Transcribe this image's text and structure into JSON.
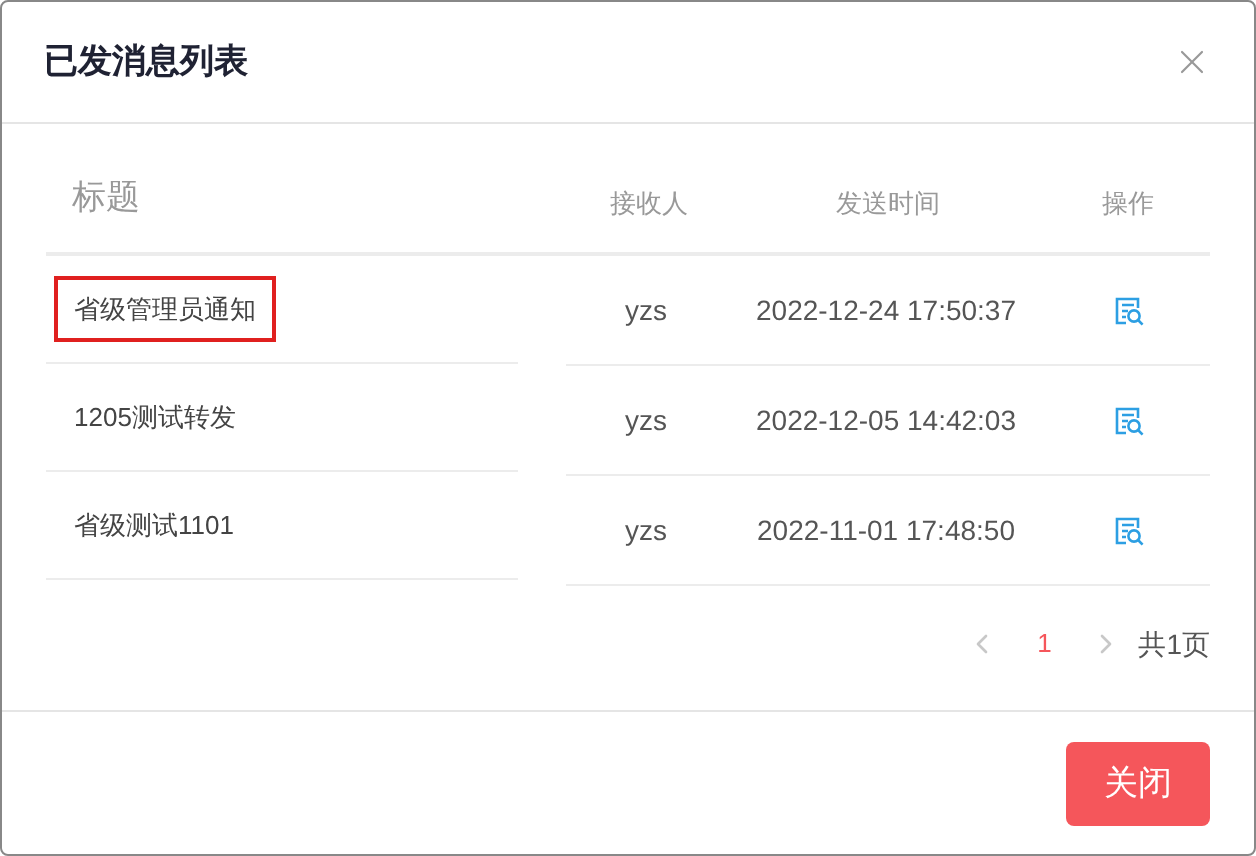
{
  "dialog": {
    "title": "已发消息列表"
  },
  "table": {
    "columns": [
      "标题",
      "接收人",
      "发送时间",
      "操作"
    ],
    "rows": [
      {
        "title": "省级管理员通知",
        "recipient": "yzs",
        "sent_time": "2022-12-24 17:50:37",
        "highlighted": true
      },
      {
        "title": "1205测试转发",
        "recipient": "yzs",
        "sent_time": "2022-12-05 14:42:03",
        "highlighted": false
      },
      {
        "title": "省级测试1101",
        "recipient": "yzs",
        "sent_time": "2022-11-01 17:48:50",
        "highlighted": false
      }
    ]
  },
  "pagination": {
    "pages": [
      {
        "label": "1",
        "selected": true
      }
    ],
    "total": "共1页"
  },
  "buttons": [
    "关闭"
  ]
}
